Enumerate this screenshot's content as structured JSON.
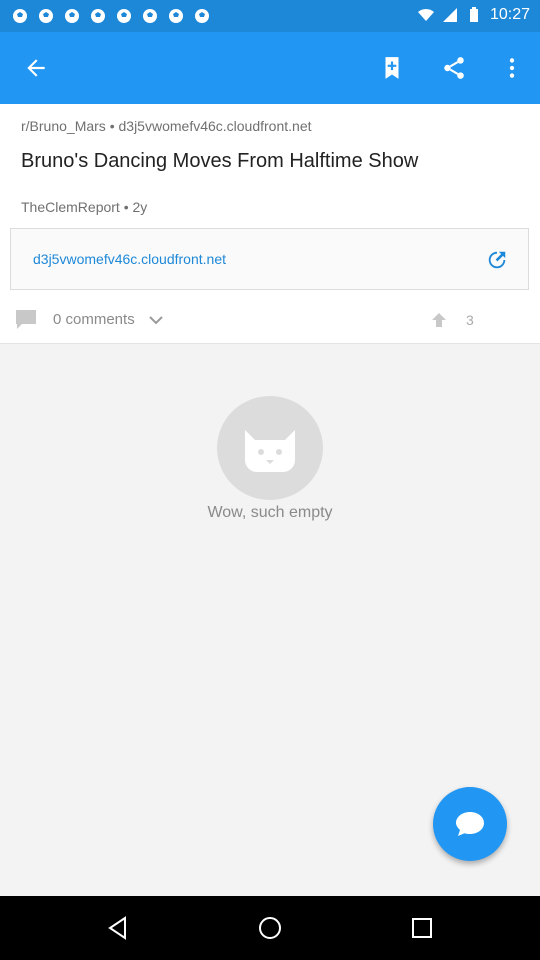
{
  "status_bar": {
    "time": "10:27",
    "left_icons": [
      "soccer-ball-icon",
      "soccer-ball-icon",
      "soccer-ball-icon",
      "soccer-ball-icon",
      "soccer-ball-icon",
      "soccer-ball-icon",
      "soccer-ball-icon",
      "soccer-ball-icon"
    ],
    "right_icons": [
      "wifi-icon",
      "signal-icon",
      "battery-icon"
    ]
  },
  "toolbar": {
    "background": "#2196f3",
    "icons": [
      "back-arrow-icon",
      "bookmark-add-icon",
      "share-icon",
      "more-vert-icon"
    ]
  },
  "post": {
    "subreddit": "r/Bruno_Mars",
    "separator": "•",
    "domain": "d3j5vwomefv46c.cloudfront.net",
    "title": "Bruno's Dancing Moves From Halftime Show",
    "author": "TheClemReport",
    "age": "2y",
    "link_url": "d3j5vwomefv46c.cloudfront.net",
    "comments_label": "0 comments",
    "score": "3"
  },
  "empty_state": {
    "icon": "cat-face-icon",
    "text": "Wow, such empty"
  },
  "fab": {
    "icon": "chat-bubble-icon"
  },
  "nav_bar": {
    "icons": [
      "back-triangle-icon",
      "home-circle-icon",
      "recents-square-icon"
    ]
  },
  "colors": {
    "accent": "#2196f3",
    "link": "#1e88d8",
    "muted_text": "#707070"
  }
}
